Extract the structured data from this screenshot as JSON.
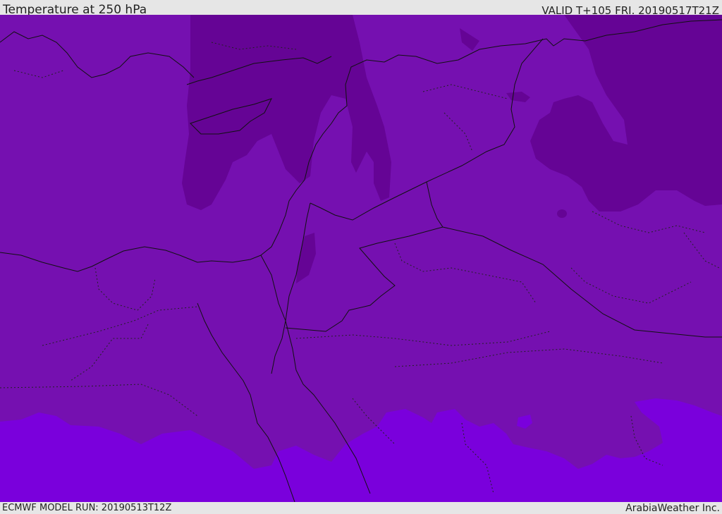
{
  "header": {
    "title": "Temperature at 250 hPa",
    "valid": "VALID T+105 FRI. 20190517T21Z"
  },
  "footer": {
    "model_run": "ECMWF MODEL RUN: 20190513T12Z",
    "credit": "ArabiaWeather Inc."
  },
  "colors": {
    "band_cold": "#650495",
    "band_mid": "#7510b0",
    "band_warm": "#7a00dc",
    "border": "#111111"
  }
}
